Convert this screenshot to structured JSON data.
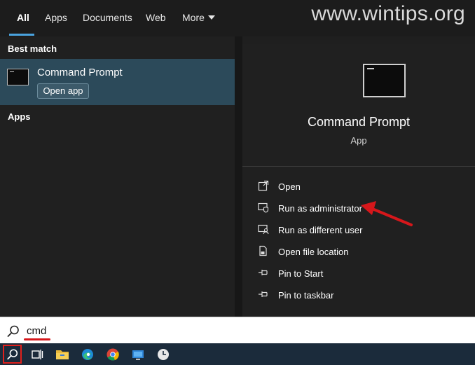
{
  "tabs": [
    {
      "label": "All",
      "active": true
    },
    {
      "label": "Apps"
    },
    {
      "label": "Documents"
    },
    {
      "label": "Web"
    },
    {
      "label": "More"
    }
  ],
  "watermark": "www.wintips.org",
  "results": {
    "best_match_label": "Best match",
    "best_match": {
      "title": "Command Prompt",
      "open_button": "Open app",
      "icon": "terminal-icon"
    },
    "apps_label": "Apps"
  },
  "detail": {
    "title": "Command Prompt",
    "subtitle": "App",
    "icon": "terminal-icon",
    "actions": [
      {
        "label": "Open",
        "icon": "open-icon"
      },
      {
        "label": "Run as administrator",
        "icon": "shield-admin-icon"
      },
      {
        "label": "Run as different user",
        "icon": "user-switch-icon"
      },
      {
        "label": "Open file location",
        "icon": "folder-location-icon"
      },
      {
        "label": "Pin to Start",
        "icon": "pin-icon"
      },
      {
        "label": "Pin to taskbar",
        "icon": "pin-icon"
      }
    ]
  },
  "search": {
    "value": "cmd",
    "icon": "search-icon"
  },
  "taskbar": {
    "items": [
      "search-icon",
      "task-view-icon",
      "file-explorer-icon",
      "edge-icon",
      "chrome-icon",
      "remote-desktop-icon",
      "clock-icon"
    ]
  },
  "colors": {
    "highlight": "#2c4a5a",
    "accent_underline": "#4aa3df",
    "annotation_red": "#d6171b"
  }
}
